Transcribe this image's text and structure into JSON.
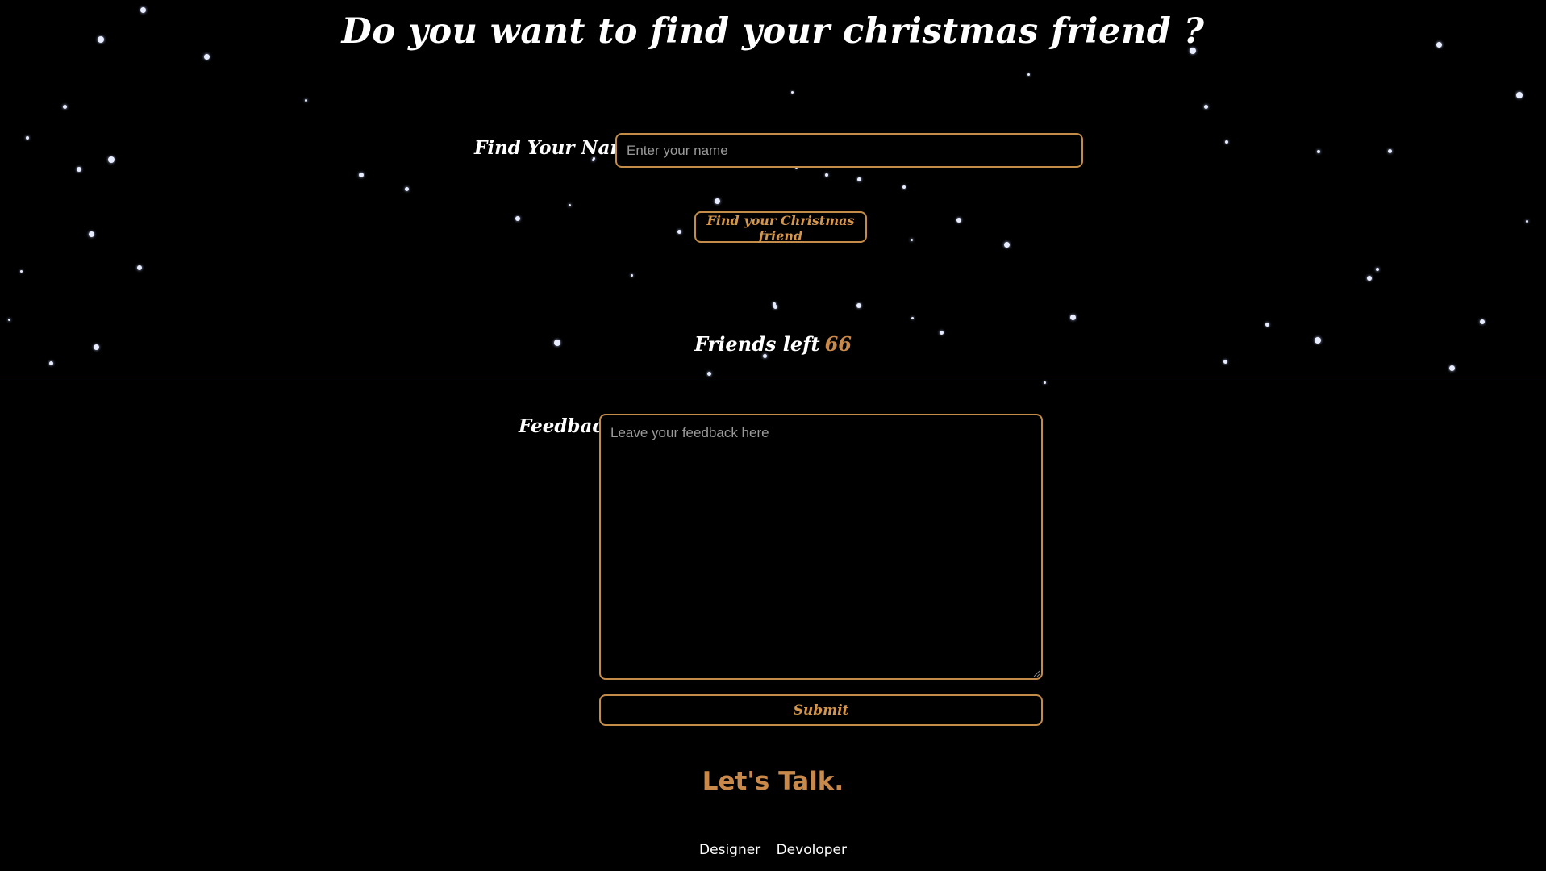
{
  "header": {
    "title": "Do you want to find your christmas friend ?"
  },
  "find_form": {
    "name_label": "Find Your Name",
    "name_input_value": "",
    "name_input_placeholder": "Enter your name",
    "find_button_label": "Find your Christmas friend"
  },
  "friends": {
    "label": "Friends left",
    "count": "66"
  },
  "feedback_form": {
    "label": "Feedback",
    "textarea_value": "",
    "textarea_placeholder": "Leave your feedback here",
    "submit_label": "Submit"
  },
  "contact": {
    "heading": "Let's Talk.",
    "links": [
      "Designer",
      "Devoloper"
    ]
  },
  "theme": {
    "background": "#000000",
    "accent": "#c48c49",
    "text": "#ffffff",
    "snowflake": "#e7ecff"
  }
}
